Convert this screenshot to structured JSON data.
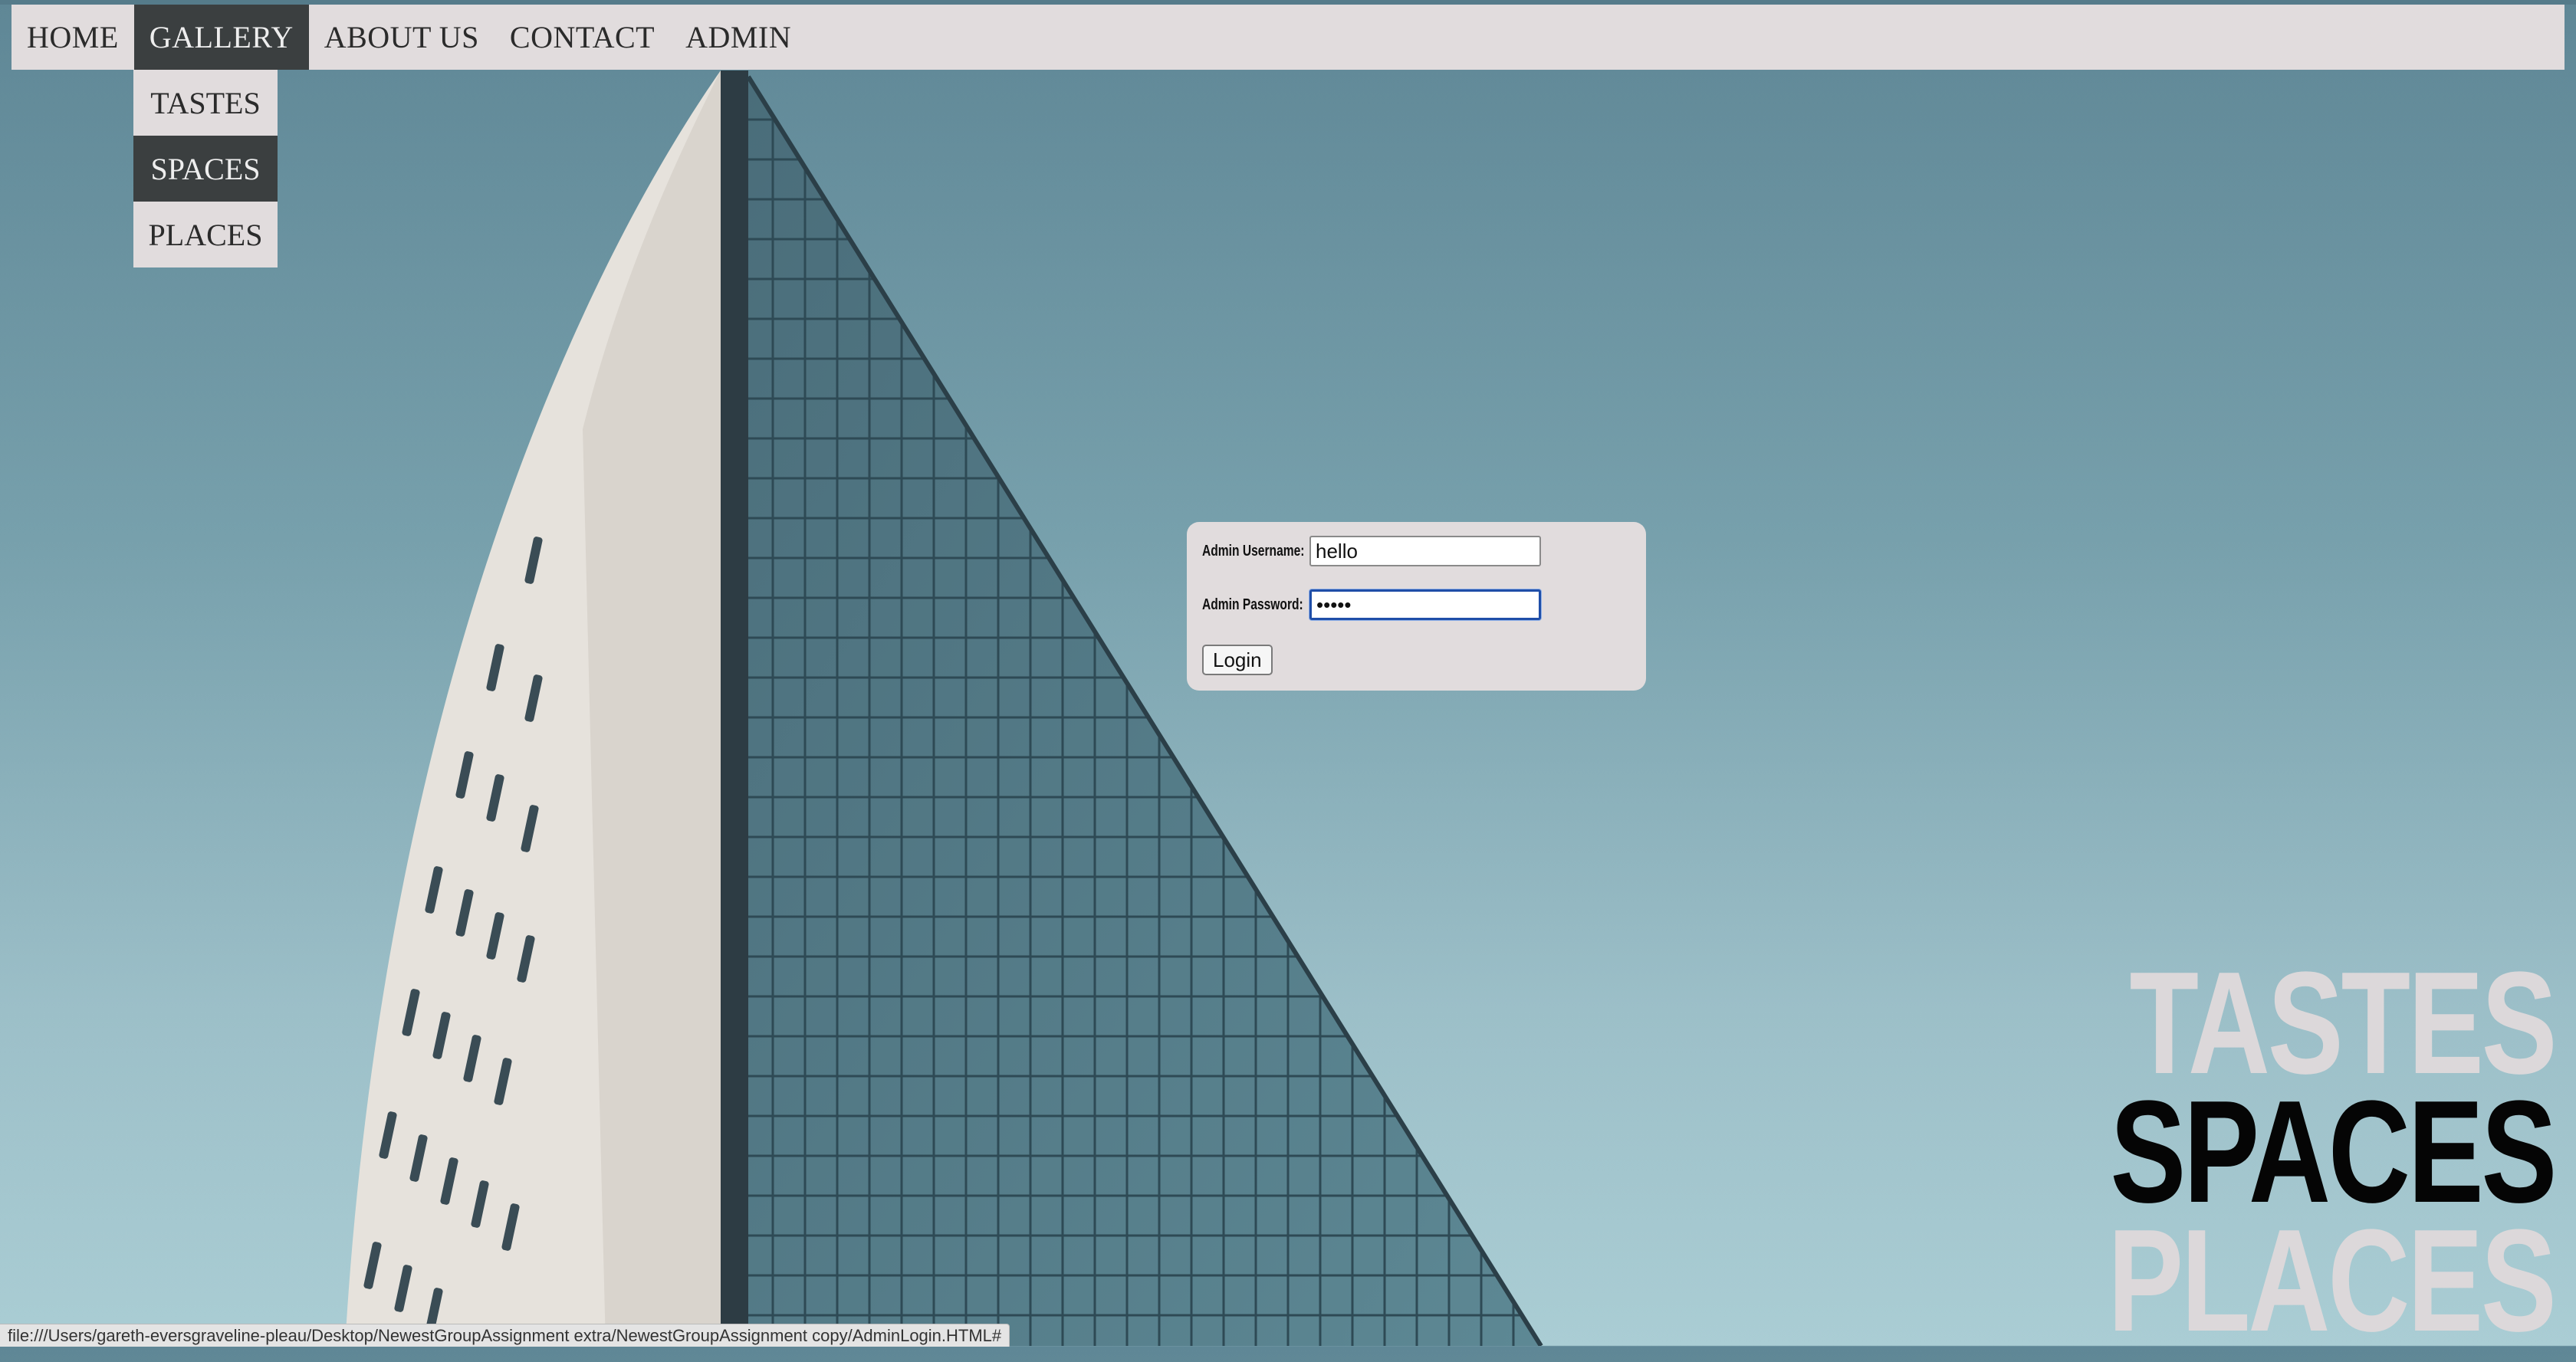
{
  "nav": {
    "items": [
      {
        "label": "HOME"
      },
      {
        "label": "GALLERY"
      },
      {
        "label": "ABOUT US"
      },
      {
        "label": "CONTACT"
      },
      {
        "label": "ADMIN"
      }
    ],
    "active": "GALLERY"
  },
  "dropdown": {
    "items": [
      {
        "label": "TASTES"
      },
      {
        "label": "SPACES"
      },
      {
        "label": "PLACES"
      }
    ],
    "hovered": "SPACES"
  },
  "login": {
    "username_label": "Admin Username:",
    "username_value": "hello",
    "password_label": "Admin Password:",
    "password_value": "•••••",
    "button_label": "Login"
  },
  "hero": {
    "word1": "TASTES",
    "word2": "SPACES",
    "word3": "PLACES"
  },
  "status_bar": {
    "url": "file:///Users/gareth-eversgraveline-pleau/Desktop/NewestGroupAssignment extra/NewestGroupAssignment copy/AdminLogin.HTML#"
  },
  "colors": {
    "nav_bg": "#e1dcdd",
    "nav_active": "#3b3f40",
    "sky_top": "#5f8796",
    "sky_bottom": "#aacdd4"
  }
}
